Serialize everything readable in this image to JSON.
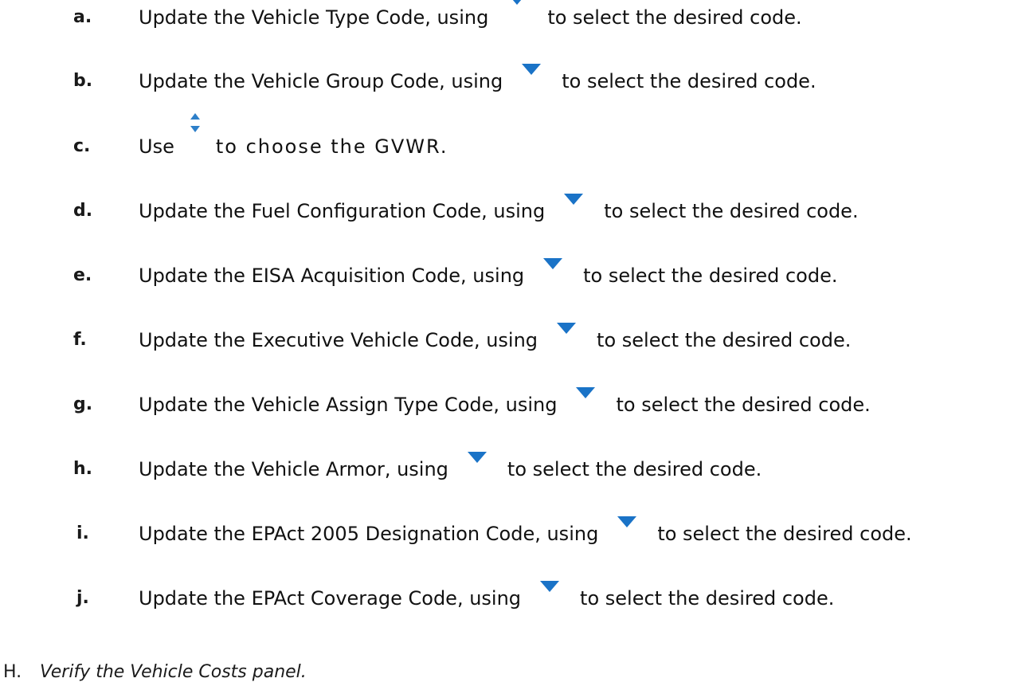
{
  "steps": [
    {
      "letter": "a.",
      "before": "Update the Vehicle Type Code, using",
      "icon": "dropdown-arrow-icon",
      "after": "to select the desired code."
    },
    {
      "letter": "b.",
      "before": "Update the Vehicle Group Code, using",
      "icon": "dropdown-arrow-icon",
      "after": "to select the desired code."
    },
    {
      "letter": "c.",
      "before": "Use",
      "icon": "spinner-arrows-icon",
      "after": "to choose the GVWR."
    },
    {
      "letter": "d.",
      "before": "Update the Fuel Configuration Code, using",
      "icon": "dropdown-arrow-icon",
      "after": "to select the desired code."
    },
    {
      "letter": "e.",
      "before": "Update the EISA Acquisition Code, using",
      "icon": "dropdown-arrow-icon",
      "after": "to select the desired code."
    },
    {
      "letter": "f.",
      "before": "Update the Executive Vehicle Code, using",
      "icon": "dropdown-arrow-icon",
      "after": "to select the desired code."
    },
    {
      "letter": "g.",
      "before": "Update the Vehicle Assign Type Code, using",
      "icon": "dropdown-arrow-icon",
      "after": "to select the desired code."
    },
    {
      "letter": "h.",
      "before": "Update the Vehicle Armor, using",
      "icon": "dropdown-arrow-icon",
      "after": "to select the desired code."
    },
    {
      "letter": "i.",
      "before": "Update the EPAct 2005 Designation Code, using",
      "icon": "dropdown-arrow-icon",
      "after": "to select the desired code."
    },
    {
      "letter": "j.",
      "before": "Update the EPAct Coverage Code, using",
      "icon": "dropdown-arrow-icon",
      "after": "to select the desired code."
    }
  ],
  "section": {
    "number": "H.",
    "title": "Verify the Vehicle Costs panel."
  },
  "colors": {
    "icon_blue": "#1a73c7",
    "text": "#1a1a1a"
  }
}
